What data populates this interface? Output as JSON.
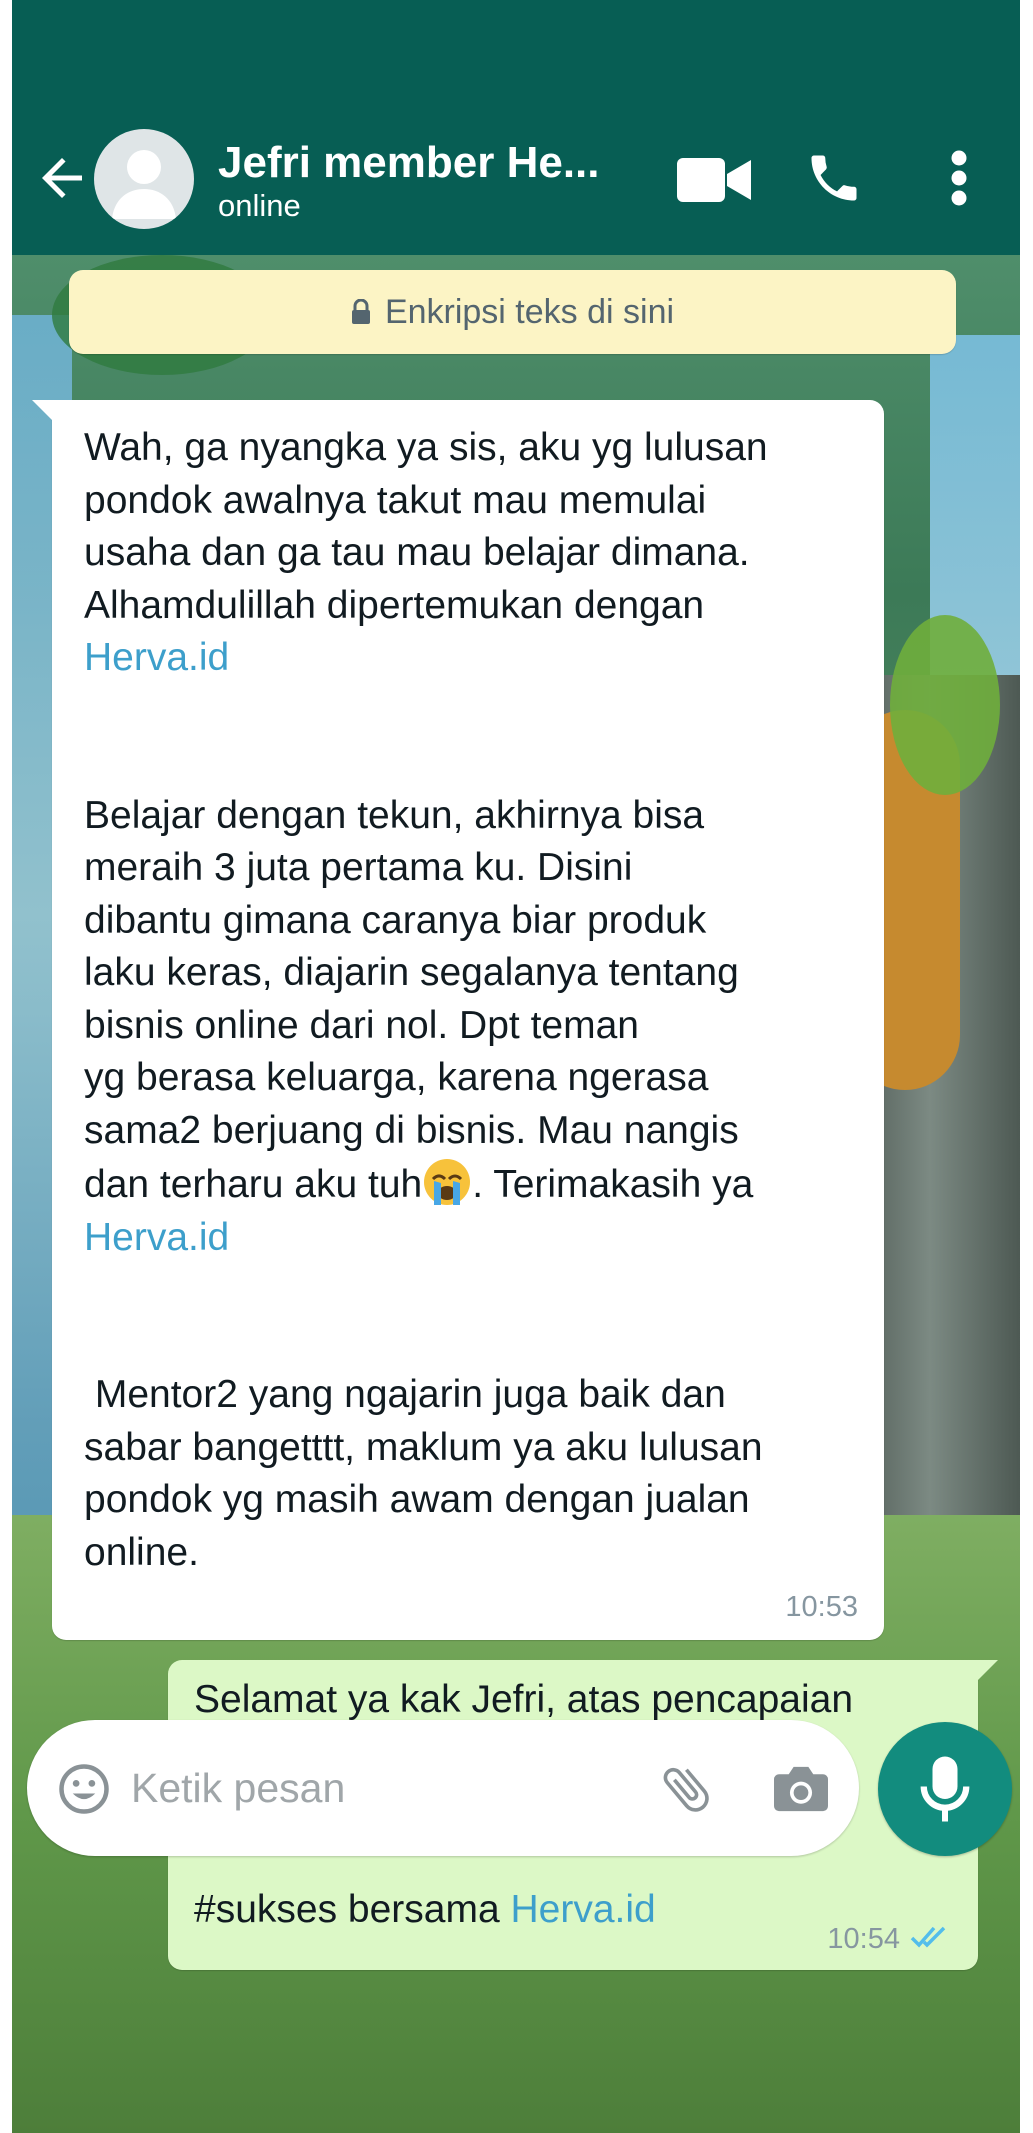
{
  "header": {
    "contact_name": "Jefri member He...",
    "contact_status": "online",
    "icons": [
      "back-arrow-icon",
      "avatar-placeholder",
      "video-call-icon",
      "phone-call-icon",
      "more-vert-icon"
    ]
  },
  "encryption_banner": {
    "text": "Enkripsi teks di sini",
    "icon": "lock-icon",
    "background": "#fcf4c5"
  },
  "messages": [
    {
      "direction": "incoming",
      "paragraphs": [
        {
          "text": "Wah, ga nyangka ya sis, aku yg lulusan\npondok awalnya takut mau memulai\nusaha dan ga tau mau belajar dimana.\nAlhamdulillah dipertemukan dengan\n",
          "link": "Herva.id"
        },
        {
          "text_before_emoji": "\n\n\nBelajar dengan tekun, akhirnya bisa\nmeraih 3 juta pertama ku. Disini\ndibantu gimana caranya biar produk\nlaku keras, diajarin segalanya tentang\nbisnis online dari nol. Dpt teman\nyg berasa keluarga, karena ngerasa\nsama2 berjuang di bisnis. Mau nangis\ndan terharu aku tuh",
          "emoji": "loudly-crying-face",
          "text_after_emoji": ". Terimakasih ya\n",
          "link": "Herva.id"
        },
        {
          "text": "\n\n\n Mentor2 yang ngajarin juga baik dan\nsabar bangetttt, maklum ya aku lulusan\npondok yg masih awam dengan jualan\nonline."
        }
      ],
      "time": "10:53"
    },
    {
      "direction": "outgoing",
      "text": "Selamat ya kak Jefri, atas pencapaian\nnya kak. Terus belajar, semoga makin\nsukses ya kak.\n\n#sukses bersama ",
      "link": "Herva.id",
      "time": "10:54",
      "status_icon": "double-check-read-icon"
    }
  ],
  "input_bar": {
    "placeholder": "Ketik pesan",
    "icons": [
      "emoji-icon",
      "attach-icon",
      "camera-icon",
      "mic-icon"
    ]
  },
  "colors": {
    "header": "#075e54",
    "incoming_bubble": "#ffffff",
    "outgoing_bubble": "#dcf8c6",
    "link": "#3d9fcb",
    "mic_button": "#128c7e",
    "read_ticks": "#53bdeb"
  }
}
